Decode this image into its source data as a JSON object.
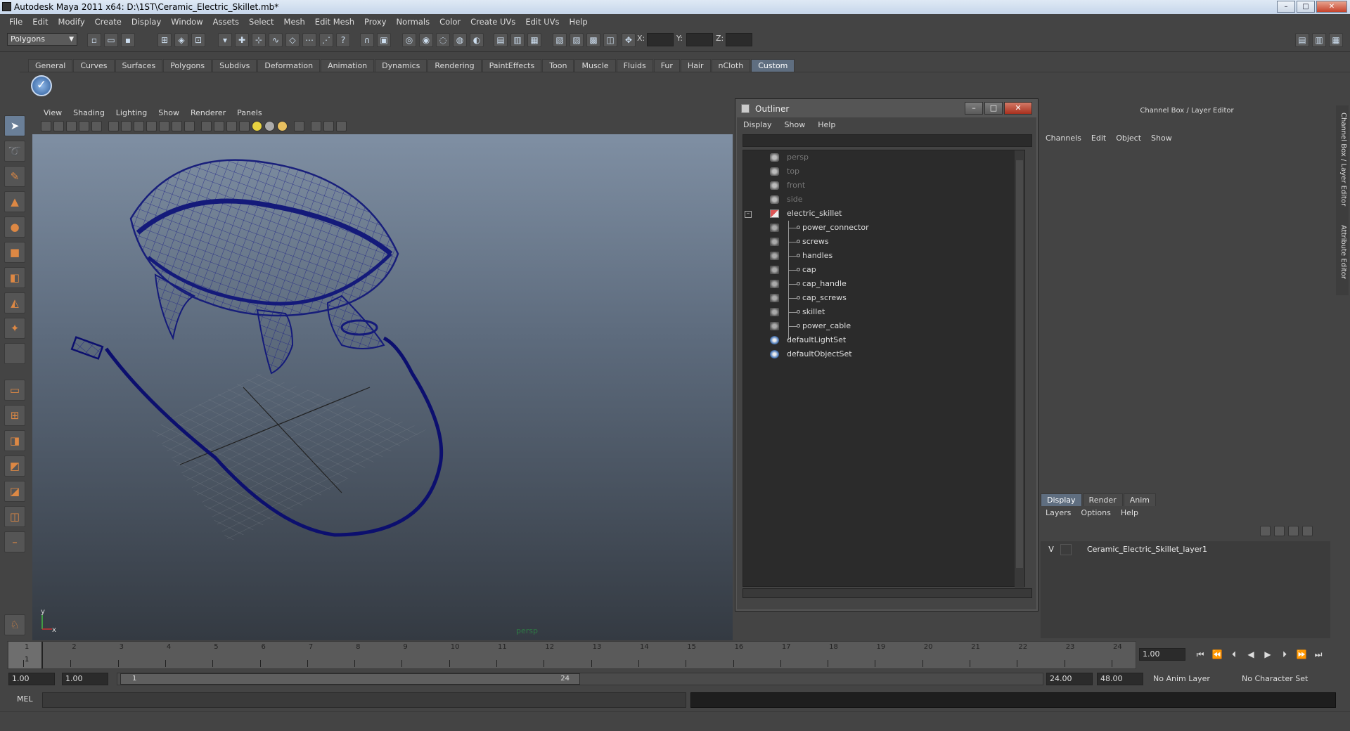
{
  "window": {
    "title": "Autodesk Maya 2011 x64: D:\\1ST\\Ceramic_Electric_Skillet.mb*",
    "buttons": [
      "–",
      "□",
      "✕"
    ]
  },
  "menubar": [
    "File",
    "Edit",
    "Modify",
    "Create",
    "Display",
    "Window",
    "Assets",
    "Select",
    "Mesh",
    "Edit Mesh",
    "Proxy",
    "Normals",
    "Color",
    "Create UVs",
    "Edit UVs",
    "Help"
  ],
  "statusline": {
    "mode": "Polygons",
    "x_label": "X:",
    "y_label": "Y:",
    "z_label": "Z:"
  },
  "shelf": {
    "tabs": [
      "General",
      "Curves",
      "Surfaces",
      "Polygons",
      "Subdivs",
      "Deformation",
      "Animation",
      "Dynamics",
      "Rendering",
      "PaintEffects",
      "Toon",
      "Muscle",
      "Fluids",
      "Fur",
      "Hair",
      "nCloth",
      "Custom"
    ],
    "active_tab": "Custom"
  },
  "viewport": {
    "menu": [
      "View",
      "Shading",
      "Lighting",
      "Show",
      "Renderer",
      "Panels"
    ],
    "camera_label": "persp",
    "axis_y": "y",
    "axis_x": "x"
  },
  "outliner": {
    "title": "Outliner",
    "menu": [
      "Display",
      "Show",
      "Help"
    ],
    "items": [
      {
        "label": "persp",
        "type": "camera",
        "dim": true
      },
      {
        "label": "top",
        "type": "camera",
        "dim": true
      },
      {
        "label": "front",
        "type": "camera",
        "dim": true
      },
      {
        "label": "side",
        "type": "camera",
        "dim": true
      },
      {
        "label": "electric_skillet",
        "type": "group",
        "dim": false
      },
      {
        "label": "power_connector",
        "type": "mesh",
        "dim": false
      },
      {
        "label": "screws",
        "type": "mesh",
        "dim": false
      },
      {
        "label": "handles",
        "type": "mesh",
        "dim": false
      },
      {
        "label": "cap",
        "type": "mesh",
        "dim": false
      },
      {
        "label": "cap_handle",
        "type": "mesh",
        "dim": false
      },
      {
        "label": "cap_screws",
        "type": "mesh",
        "dim": false
      },
      {
        "label": "skillet",
        "type": "mesh",
        "dim": false
      },
      {
        "label": "power_cable",
        "type": "mesh",
        "dim": false
      },
      {
        "label": "defaultLightSet",
        "type": "set",
        "dim": false
      },
      {
        "label": "defaultObjectSet",
        "type": "set",
        "dim": false
      }
    ]
  },
  "channelbox": {
    "title": "Channel Box / Layer Editor",
    "menu": [
      "Channels",
      "Edit",
      "Object",
      "Show"
    ],
    "layer_tabs": [
      "Display",
      "Render",
      "Anim"
    ],
    "layer_menu": [
      "Layers",
      "Options",
      "Help"
    ],
    "layer": {
      "visible": "V",
      "name": "Ceramic_Electric_Skillet_layer1"
    },
    "side_tabs": [
      "Channel Box / Layer Editor",
      "Attribute Editor"
    ]
  },
  "timeslider": {
    "ticks": [
      "1",
      "2",
      "3",
      "4",
      "5",
      "6",
      "7",
      "8",
      "9",
      "10",
      "11",
      "12",
      "13",
      "14",
      "15",
      "16",
      "17",
      "18",
      "19",
      "20",
      "21",
      "22",
      "23",
      "24"
    ],
    "current_frame": "1",
    "current_frame_field": "1.00"
  },
  "range": {
    "start": "1.00",
    "playback_start": "1.00",
    "slider_start": "1",
    "slider_end": "24",
    "playback_end": "24.00",
    "end": "48.00",
    "anim_layer": "No Anim Layer",
    "character_set": "No Character Set"
  },
  "commandline": {
    "label": "MEL"
  }
}
